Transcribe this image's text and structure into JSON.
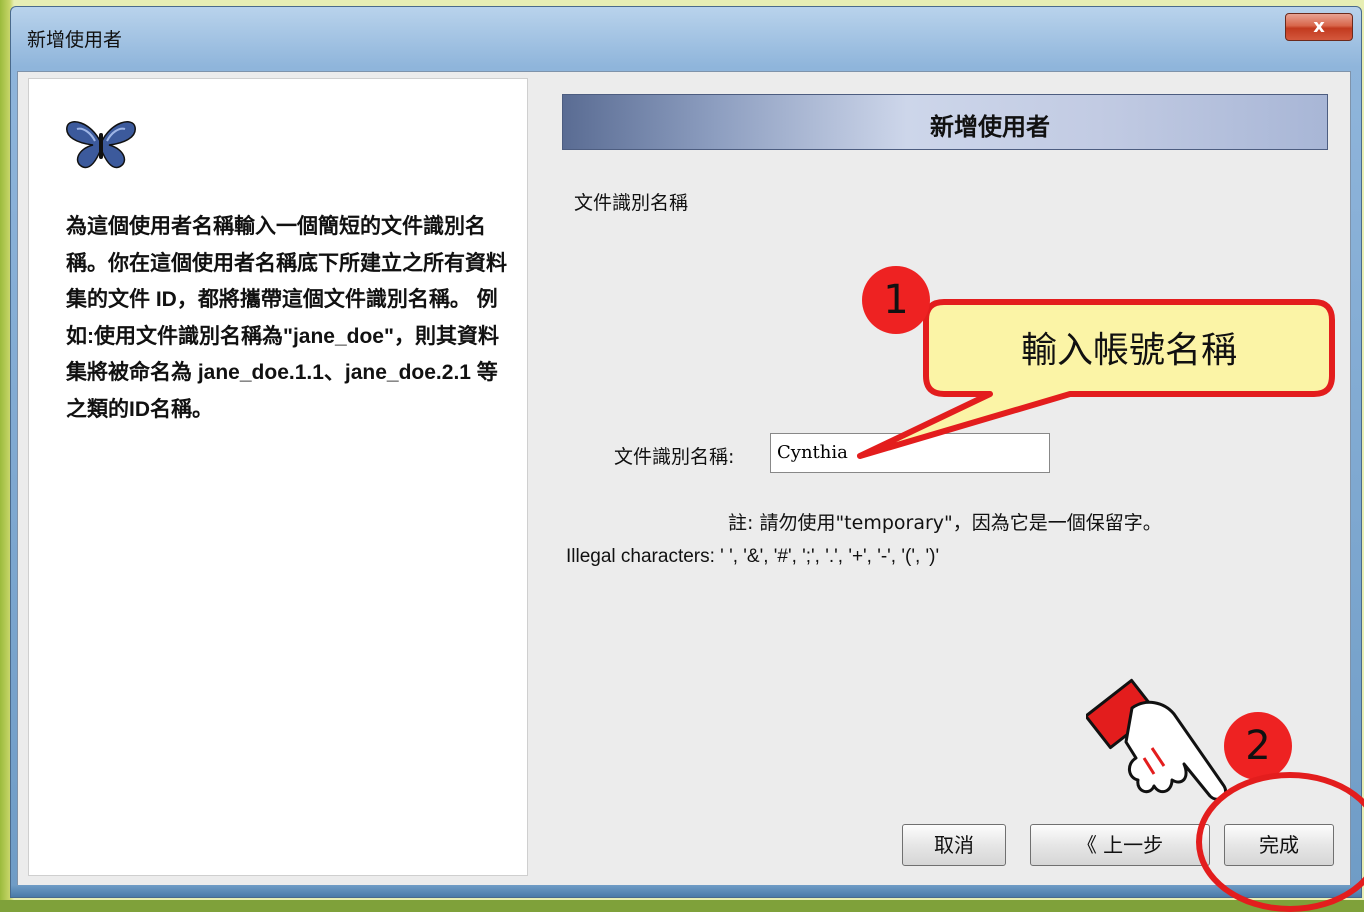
{
  "window": {
    "title": "新增使用者",
    "close_label": "x"
  },
  "left_panel": {
    "icon": "butterfly-icon",
    "description": "為這個使用者名稱輸入一個簡短的文件識別名稱。你在這個使用者名稱底下所建立之所有資料集的文件 ID，都將攜帶這個文件識別名稱。 例如:使用文件識別名稱為\"jane_doe\"，則其資料集將被命名為 jane_doe.1.1、jane_doe.2.1 等之類的ID名稱。"
  },
  "right_panel": {
    "banner_title": "新增使用者",
    "section_label": "文件識別名稱",
    "field_label": "文件識別名稱:",
    "field_value": "Cynthia",
    "note": "註: 請勿使用\"temporary\"，因為它是一個保留字。",
    "illegal_chars": "Illegal characters: ' ', '&', '#', ';', '.', '+', '-', '(', ')'"
  },
  "buttons": {
    "cancel": "取消",
    "back": "《 上一步",
    "finish": "完成"
  },
  "annotations": {
    "step1": "1",
    "callout": "輸入帳號名稱",
    "step2": "2",
    "colors": {
      "red": "#e31d1d",
      "callout_fill": "#fbf4a6"
    }
  }
}
